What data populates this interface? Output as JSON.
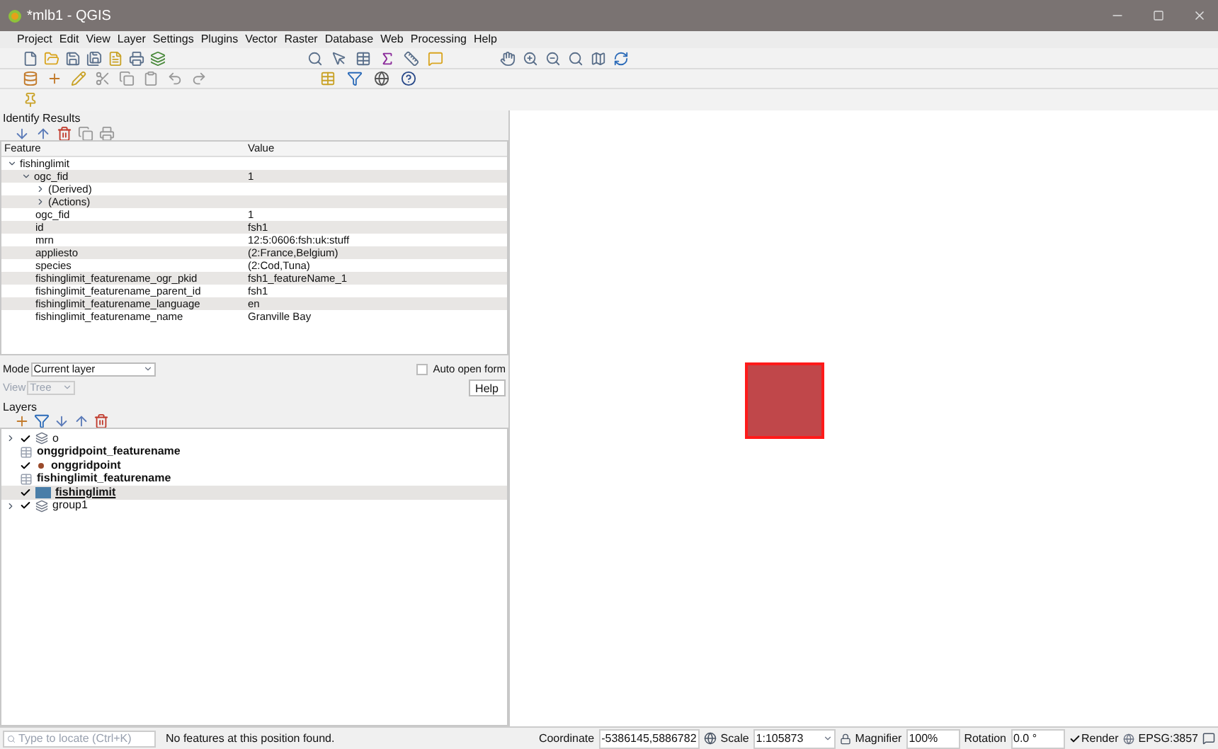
{
  "window": {
    "title": "*mlb1 - QGIS"
  },
  "menu": [
    "Project",
    "Edit",
    "View",
    "Layer",
    "Settings",
    "Plugins",
    "Vector",
    "Raster",
    "Database",
    "Web",
    "Processing",
    "Help"
  ],
  "identify": {
    "title": "Identify Results",
    "columns": [
      "Feature",
      "Value"
    ],
    "rows": [
      {
        "feature": "fishinglimit",
        "expanded": true,
        "children": [
          {
            "feature": "ogc_fid",
            "value": "1",
            "expanded": true,
            "children": [
              {
                "feature": "(Derived)",
                "expanded": false
              },
              {
                "feature": "(Actions)",
                "expanded": false
              },
              {
                "feature": "ogc_fid",
                "value": "1"
              },
              {
                "feature": "id",
                "value": "fsh1"
              },
              {
                "feature": "mrn",
                "value": "12:5:0606:fsh:uk:stuff"
              },
              {
                "feature": "appliesto",
                "value": "(2:France,Belgium)"
              },
              {
                "feature": "species",
                "value": "(2:Cod,Tuna)"
              },
              {
                "feature": "fishinglimit_featurename_ogr_pkid",
                "value": "fsh1_featureName_1"
              },
              {
                "feature": "fishinglimit_featurename_parent_id",
                "value": "fsh1"
              },
              {
                "feature": "fishinglimit_featurename_language",
                "value": "en"
              },
              {
                "feature": "fishinglimit_featurename_name",
                "value": "Granville Bay"
              }
            ]
          }
        ]
      }
    ],
    "mode_label": "Mode",
    "mode_value": "Current layer",
    "view_label": "View",
    "view_value": "Tree",
    "auto_open": {
      "label": "Auto open form",
      "checked": false
    },
    "help": "Help"
  },
  "layers": {
    "title": "Layers",
    "items": [
      {
        "kind": "group",
        "name": "o",
        "checked": true,
        "expanded": false,
        "selected": false
      },
      {
        "kind": "table",
        "name": "onggridpoint_featurename",
        "selected": false
      },
      {
        "kind": "point",
        "name": "onggridpoint",
        "checked": true,
        "selected": false
      },
      {
        "kind": "table",
        "name": "fishinglimit_featurename",
        "selected": false
      },
      {
        "kind": "polygon",
        "name": "fishinglimit",
        "checked": true,
        "selected": true
      },
      {
        "kind": "group",
        "name": "group1",
        "checked": true,
        "expanded": false,
        "selected": false
      }
    ]
  },
  "status_bar": {
    "locate_placeholder": "Type to locate (Ctrl+K)",
    "message": "No features at this position found.",
    "coordinate_label": "Coordinate",
    "coordinate": "-5386145,5886782",
    "scale_label": "Scale",
    "scale": "1:105873",
    "magnifier_label": "Magnifier",
    "magnifier": "100%",
    "rotation_label": "Rotation",
    "rotation": "0.0 °",
    "render": {
      "label": "Render",
      "checked": true
    },
    "crs": "EPSG:3857"
  }
}
